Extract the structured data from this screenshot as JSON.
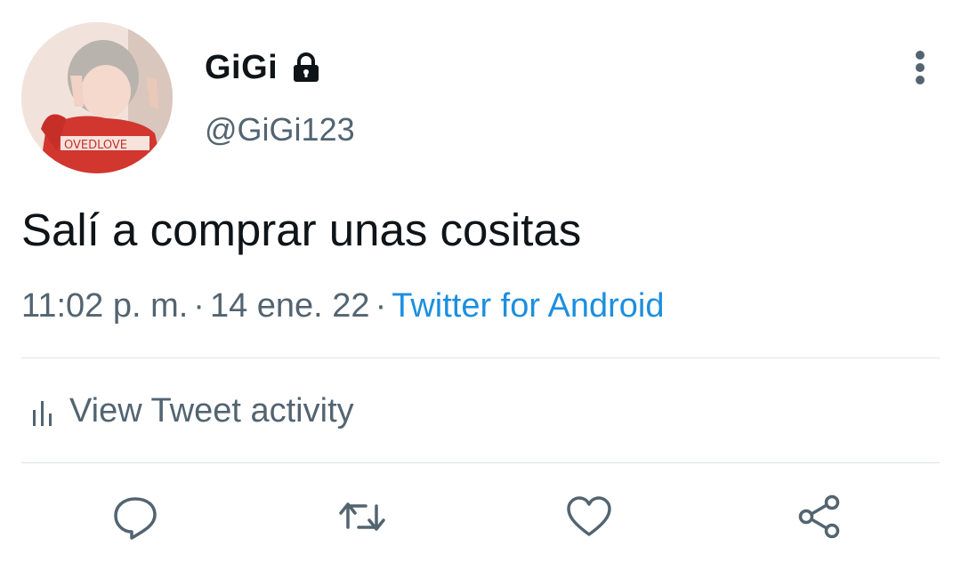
{
  "author": {
    "display_name": "GiGi",
    "handle": "@GiGi123",
    "avatar": "profile-photo",
    "locked_icon": "lock-icon"
  },
  "tweet": {
    "text": "Salí a comprar unas cositas",
    "time": "11:02 p. m.",
    "date": "14 ene. 22",
    "separator": "·",
    "source": "Twitter for Android"
  },
  "activity": {
    "label": "View Tweet activity",
    "icon": "bar-chart-icon"
  },
  "actions": [
    {
      "name": "reply",
      "icon": "reply-icon"
    },
    {
      "name": "retweet",
      "icon": "retweet-icon"
    },
    {
      "name": "like",
      "icon": "heart-icon"
    },
    {
      "name": "share",
      "icon": "share-icon"
    }
  ],
  "colors": {
    "text_primary": "#0f1419",
    "text_secondary": "#536471",
    "link": "#1d8fde",
    "divider": "#dfe3e6"
  }
}
